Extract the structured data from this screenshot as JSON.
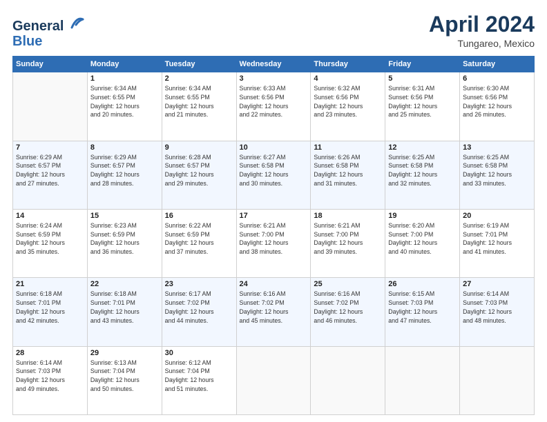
{
  "header": {
    "logo_line1": "General",
    "logo_line2": "Blue",
    "title": "April 2024",
    "location": "Tungareo, Mexico"
  },
  "calendar": {
    "columns": [
      "Sunday",
      "Monday",
      "Tuesday",
      "Wednesday",
      "Thursday",
      "Friday",
      "Saturday"
    ],
    "weeks": [
      [
        {
          "day": "",
          "info": ""
        },
        {
          "day": "1",
          "info": "Sunrise: 6:34 AM\nSunset: 6:55 PM\nDaylight: 12 hours\nand 20 minutes."
        },
        {
          "day": "2",
          "info": "Sunrise: 6:34 AM\nSunset: 6:55 PM\nDaylight: 12 hours\nand 21 minutes."
        },
        {
          "day": "3",
          "info": "Sunrise: 6:33 AM\nSunset: 6:56 PM\nDaylight: 12 hours\nand 22 minutes."
        },
        {
          "day": "4",
          "info": "Sunrise: 6:32 AM\nSunset: 6:56 PM\nDaylight: 12 hours\nand 23 minutes."
        },
        {
          "day": "5",
          "info": "Sunrise: 6:31 AM\nSunset: 6:56 PM\nDaylight: 12 hours\nand 25 minutes."
        },
        {
          "day": "6",
          "info": "Sunrise: 6:30 AM\nSunset: 6:56 PM\nDaylight: 12 hours\nand 26 minutes."
        }
      ],
      [
        {
          "day": "7",
          "info": "Sunrise: 6:29 AM\nSunset: 6:57 PM\nDaylight: 12 hours\nand 27 minutes."
        },
        {
          "day": "8",
          "info": "Sunrise: 6:29 AM\nSunset: 6:57 PM\nDaylight: 12 hours\nand 28 minutes."
        },
        {
          "day": "9",
          "info": "Sunrise: 6:28 AM\nSunset: 6:57 PM\nDaylight: 12 hours\nand 29 minutes."
        },
        {
          "day": "10",
          "info": "Sunrise: 6:27 AM\nSunset: 6:58 PM\nDaylight: 12 hours\nand 30 minutes."
        },
        {
          "day": "11",
          "info": "Sunrise: 6:26 AM\nSunset: 6:58 PM\nDaylight: 12 hours\nand 31 minutes."
        },
        {
          "day": "12",
          "info": "Sunrise: 6:25 AM\nSunset: 6:58 PM\nDaylight: 12 hours\nand 32 minutes."
        },
        {
          "day": "13",
          "info": "Sunrise: 6:25 AM\nSunset: 6:58 PM\nDaylight: 12 hours\nand 33 minutes."
        }
      ],
      [
        {
          "day": "14",
          "info": "Sunrise: 6:24 AM\nSunset: 6:59 PM\nDaylight: 12 hours\nand 35 minutes."
        },
        {
          "day": "15",
          "info": "Sunrise: 6:23 AM\nSunset: 6:59 PM\nDaylight: 12 hours\nand 36 minutes."
        },
        {
          "day": "16",
          "info": "Sunrise: 6:22 AM\nSunset: 6:59 PM\nDaylight: 12 hours\nand 37 minutes."
        },
        {
          "day": "17",
          "info": "Sunrise: 6:21 AM\nSunset: 7:00 PM\nDaylight: 12 hours\nand 38 minutes."
        },
        {
          "day": "18",
          "info": "Sunrise: 6:21 AM\nSunset: 7:00 PM\nDaylight: 12 hours\nand 39 minutes."
        },
        {
          "day": "19",
          "info": "Sunrise: 6:20 AM\nSunset: 7:00 PM\nDaylight: 12 hours\nand 40 minutes."
        },
        {
          "day": "20",
          "info": "Sunrise: 6:19 AM\nSunset: 7:01 PM\nDaylight: 12 hours\nand 41 minutes."
        }
      ],
      [
        {
          "day": "21",
          "info": "Sunrise: 6:18 AM\nSunset: 7:01 PM\nDaylight: 12 hours\nand 42 minutes."
        },
        {
          "day": "22",
          "info": "Sunrise: 6:18 AM\nSunset: 7:01 PM\nDaylight: 12 hours\nand 43 minutes."
        },
        {
          "day": "23",
          "info": "Sunrise: 6:17 AM\nSunset: 7:02 PM\nDaylight: 12 hours\nand 44 minutes."
        },
        {
          "day": "24",
          "info": "Sunrise: 6:16 AM\nSunset: 7:02 PM\nDaylight: 12 hours\nand 45 minutes."
        },
        {
          "day": "25",
          "info": "Sunrise: 6:16 AM\nSunset: 7:02 PM\nDaylight: 12 hours\nand 46 minutes."
        },
        {
          "day": "26",
          "info": "Sunrise: 6:15 AM\nSunset: 7:03 PM\nDaylight: 12 hours\nand 47 minutes."
        },
        {
          "day": "27",
          "info": "Sunrise: 6:14 AM\nSunset: 7:03 PM\nDaylight: 12 hours\nand 48 minutes."
        }
      ],
      [
        {
          "day": "28",
          "info": "Sunrise: 6:14 AM\nSunset: 7:03 PM\nDaylight: 12 hours\nand 49 minutes."
        },
        {
          "day": "29",
          "info": "Sunrise: 6:13 AM\nSunset: 7:04 PM\nDaylight: 12 hours\nand 50 minutes."
        },
        {
          "day": "30",
          "info": "Sunrise: 6:12 AM\nSunset: 7:04 PM\nDaylight: 12 hours\nand 51 minutes."
        },
        {
          "day": "",
          "info": ""
        },
        {
          "day": "",
          "info": ""
        },
        {
          "day": "",
          "info": ""
        },
        {
          "day": "",
          "info": ""
        }
      ]
    ]
  }
}
